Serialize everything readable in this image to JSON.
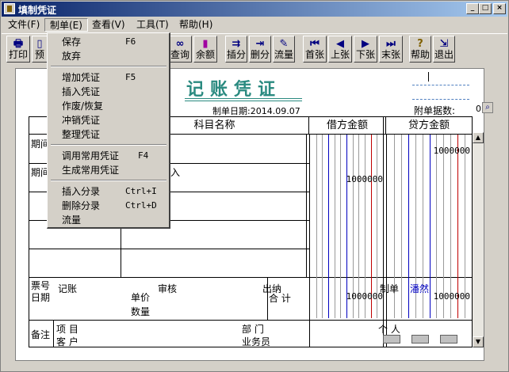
{
  "window": {
    "title": "填制凭证"
  },
  "menu": [
    {
      "label": "文件(F)"
    },
    {
      "label": "制单(E)"
    },
    {
      "label": "查看(V)"
    },
    {
      "label": "工具(T)"
    },
    {
      "label": "帮助(H)"
    }
  ],
  "toolbar": [
    {
      "label": "打印",
      "icon": "printer-icon"
    },
    {
      "label": "预",
      "icon": "preview-icon"
    },
    {
      "label": "查询",
      "icon": "binoculars-icon"
    },
    {
      "label": "余额",
      "icon": "chart-icon"
    },
    {
      "label": "插分",
      "icon": "insert-split-icon"
    },
    {
      "label": "删分",
      "icon": "delete-split-icon"
    },
    {
      "label": "流量",
      "icon": "flow-icon"
    },
    {
      "label": "首张",
      "icon": "first-icon"
    },
    {
      "label": "上张",
      "icon": "prev-icon"
    },
    {
      "label": "下张",
      "icon": "next-icon"
    },
    {
      "label": "末张",
      "icon": "last-icon"
    },
    {
      "label": "帮助",
      "icon": "help-icon"
    },
    {
      "label": "退出",
      "icon": "exit-icon"
    }
  ],
  "dropdown": {
    "items": [
      {
        "label": "保存",
        "shortcut": "F6"
      },
      {
        "label": "放弃",
        "shortcut": ""
      },
      {
        "label": "增加凭证",
        "shortcut": "F5"
      },
      {
        "label": "插入凭证",
        "shortcut": ""
      },
      {
        "label": "作废/恢复",
        "shortcut": ""
      },
      {
        "label": "冲销凭证",
        "shortcut": ""
      },
      {
        "label": "整理凭证",
        "shortcut": ""
      },
      {
        "label": "调用常用凭证",
        "shortcut": "F4"
      },
      {
        "label": "生成常用凭证",
        "shortcut": ""
      },
      {
        "label": "插入分录",
        "shortcut": "Ctrl+I"
      },
      {
        "label": "删除分录",
        "shortcut": "Ctrl+D"
      },
      {
        "label": "流量",
        "shortcut": ""
      }
    ]
  },
  "voucher": {
    "title": "记账凭证",
    "date_label": "制单日期:2014.09.07",
    "attach_label": "附单据数:",
    "attach_value": "0",
    "col_subject": "科目名称",
    "col_debit": "借方金额",
    "col_credit": "贷方金额",
    "row1_summary": "期间",
    "row2_summary": "期间",
    "row2_subject_tail": "入",
    "row1_credit": "1000000",
    "row2_debit": "1000000",
    "ticket_no": "票号",
    "date": "日期",
    "unit_price": "单价",
    "quantity": "数量",
    "total_label": "合 计",
    "total_debit": "1000000",
    "total_credit": "1000000",
    "remarks": "备注",
    "project": "项  目",
    "customer": "客  户",
    "department": "部  门",
    "salesman": "业务员",
    "person": "个  人"
  },
  "signatures": {
    "bookkeeping": "记账",
    "review": "审核",
    "cashier": "出纳",
    "maker_label": "制单",
    "maker_name": "潘然"
  },
  "colors": {
    "accent": "#2a8a80",
    "maker": "#0000c0",
    "debit_line": "#0000c0",
    "credit_line": "#c00000"
  }
}
